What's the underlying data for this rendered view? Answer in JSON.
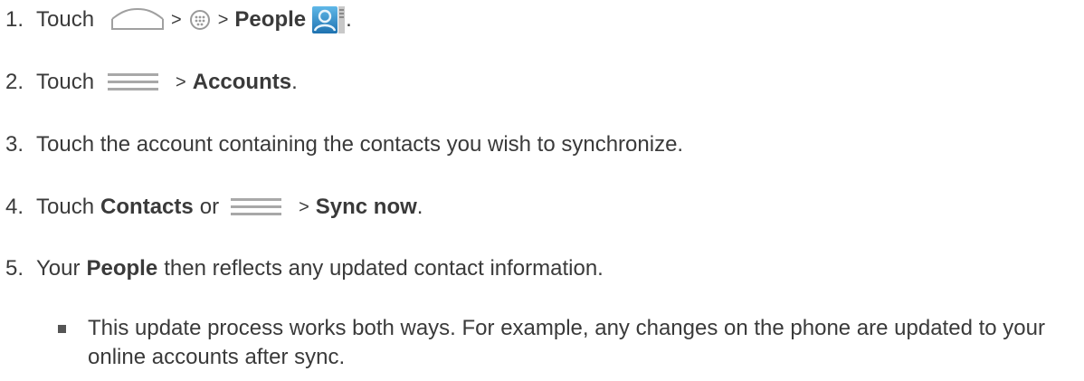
{
  "steps": [
    {
      "num": "1.",
      "text_a": "Touch",
      "sep1": ">",
      "sep2": ">",
      "bold": "People",
      "end": ".",
      "icons": [
        "home-icon",
        "apps-icon",
        "people-app-icon"
      ]
    },
    {
      "num": "2.",
      "text_a": "Touch",
      "sep": ">",
      "bold": "Accounts",
      "end": ".",
      "icons": [
        "menu-icon"
      ]
    },
    {
      "num": "3.",
      "text": "Touch the account containing the contacts you wish to synchronize."
    },
    {
      "num": "4.",
      "text_a": "Touch",
      "bold1": "Contacts",
      "text_b": "or",
      "sep": ">",
      "bold2": "Sync now",
      "end": ".",
      "icons": [
        "menu-icon"
      ]
    },
    {
      "num": "5.",
      "text_a": "Your",
      "bold": "People",
      "text_b": "then reflects any updated contact information."
    }
  ],
  "bullet": {
    "text": "This update process works both ways. For example, any changes on the phone are updated to your online accounts after sync."
  },
  "colors": {
    "text": "#3a3a3a",
    "icon_gray": "#9a9a9a",
    "people_icon_blue": "#2f8fc6"
  }
}
